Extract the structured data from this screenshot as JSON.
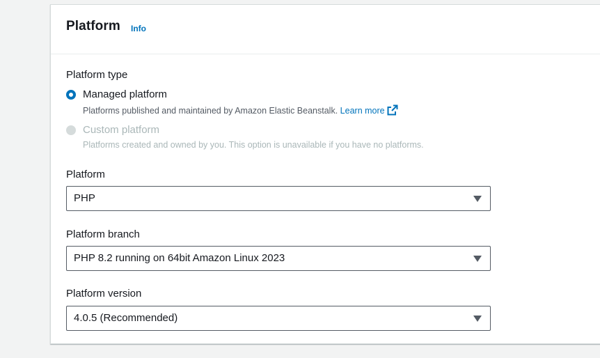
{
  "panel": {
    "title": "Platform",
    "info_label": "Info"
  },
  "platform_type": {
    "label": "Platform type",
    "options": [
      {
        "label": "Managed platform",
        "description": "Platforms published and maintained by Amazon Elastic Beanstalk.",
        "link_label": "Learn more",
        "selected": true,
        "disabled": false
      },
      {
        "label": "Custom platform",
        "description": "Platforms created and owned by you. This option is unavailable if you have no platforms.",
        "selected": false,
        "disabled": true
      }
    ]
  },
  "platform": {
    "label": "Platform",
    "value": "PHP"
  },
  "platform_branch": {
    "label": "Platform branch",
    "value": "PHP 8.2 running on 64bit Amazon Linux 2023"
  },
  "platform_version": {
    "label": "Platform version",
    "value": "4.0.5 (Recommended)"
  },
  "colors": {
    "accent": "#0073bb",
    "text": "#16191f",
    "disabled": "#aab7b8",
    "background": "#f2f3f3"
  },
  "icons": {
    "external_link": "external-link-icon",
    "dropdown": "caret-down-icon"
  }
}
